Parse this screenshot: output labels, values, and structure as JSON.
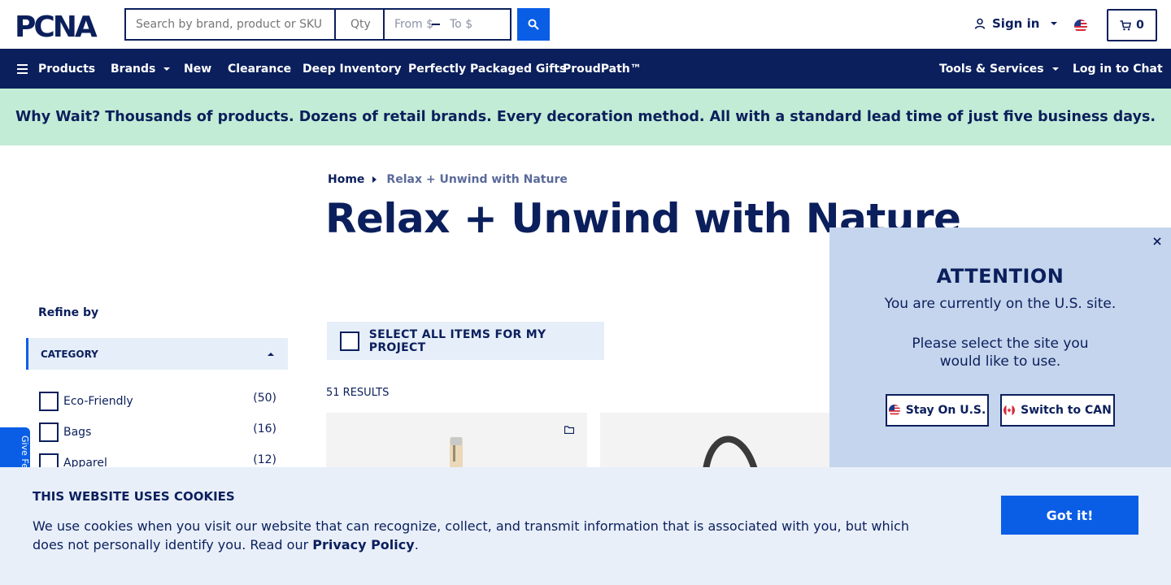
{
  "header": {
    "logo_text": "PCNA",
    "search_placeholder": "Search by brand, product or SKU",
    "qty_placeholder": "Qty",
    "price_from_placeholder": "From $",
    "price_to_placeholder": "To $",
    "signin_label": "Sign in",
    "cart_count": "0"
  },
  "nav": {
    "products": "Products",
    "brands": "Brands",
    "new": "New",
    "clearance": "Clearance",
    "deep_inventory": "Deep Inventory",
    "gifts": "Perfectly Packaged Gifts",
    "proudpath": "ProudPath™",
    "tools": "Tools & Services",
    "chat": "Log in to Chat"
  },
  "promo": {
    "text": "Why Wait? Thousands of products. Dozens of retail brands. Every decoration method. All with a standard lead time of just five business days."
  },
  "breadcrumb": {
    "home": "Home",
    "current": "Relax + Unwind with Nature"
  },
  "page": {
    "title": "Relax + Unwind with Nature",
    "select_all_label": "SELECT ALL ITEMS FOR MY PROJECT",
    "results_count": "51 RESULTS"
  },
  "filters": {
    "refine_label": "Refine by",
    "category_header": "CATEGORY",
    "categories": [
      {
        "label": "Eco-Friendly",
        "count": "(50)"
      },
      {
        "label": "Bags",
        "count": "(16)"
      },
      {
        "label": "Apparel",
        "count": "(12)"
      }
    ]
  },
  "feedback_tab": {
    "label": "Give Fe"
  },
  "site_modal": {
    "title": "ATTENTION",
    "line1": "You are currently on the U.S. site.",
    "line2": "Please select the site you would like to use.",
    "stay_label": "Stay On U.S.",
    "switch_label": "Switch to CAN"
  },
  "cookie_banner": {
    "title": "THIS WEBSITE USES COOKIES",
    "text": "We use cookies when you visit our website that can recognize, collect, and transmit information that is associated with you, but which does not personally identify you. Read our",
    "link": "Privacy Policy",
    "period": ".",
    "button": "Got it!"
  },
  "colors": {
    "navy": "#0b1f5c",
    "brand_blue": "#0a5ee6",
    "promo_green": "#c3ecd6",
    "modal_bg": "#c5d5ed",
    "cookie_bg": "#e8eff9"
  }
}
